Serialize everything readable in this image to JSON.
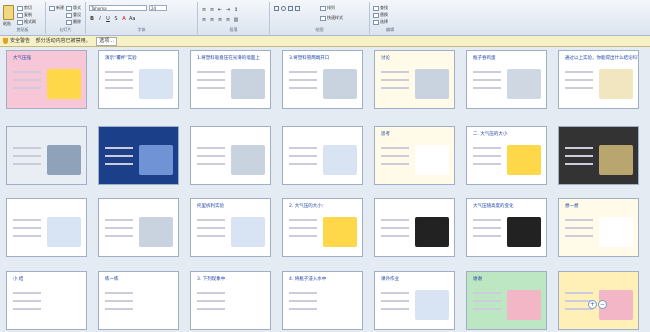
{
  "ribbon": {
    "clipboard": {
      "paste": "粘贴",
      "cut": "剪切",
      "copy": "复制",
      "format": "格式刷",
      "group": "剪贴板"
    },
    "slides": {
      "new": "新建",
      "layout": "版式",
      "reset": "重设",
      "delete": "删除",
      "group": "幻灯片"
    },
    "font": {
      "name": "Tahoma",
      "size": "24",
      "group": "字体"
    },
    "paragraph": {
      "group": "段落"
    },
    "drawing": {
      "arrange": "排列",
      "quick_styles": "快速样式",
      "group": "绘图"
    },
    "editing": {
      "find": "查找",
      "replace": "替换",
      "select": "选择",
      "group": "编辑"
    }
  },
  "security": {
    "label": "安全警告",
    "message": "部分活动内容已被禁用。",
    "button": "选项..."
  },
  "slides": [
    {
      "title": "大气压强"
    },
    {
      "title": "演示“覆杯”实验"
    },
    {
      "title": "1.将塑料吸盘压在光滑的墙面上"
    },
    {
      "title": "3.将塑料管两端开口"
    },
    {
      "title": "讨论"
    },
    {
      "title": "瓶子吞鸡蛋"
    },
    {
      "title": "通过以上实验，你能得出什么结论吗？"
    },
    {
      "title": ""
    },
    {
      "title": ""
    },
    {
      "title": ""
    },
    {
      "title": ""
    },
    {
      "title": "思考"
    },
    {
      "title": "二. 大气压的大小"
    },
    {
      "title": ""
    },
    {
      "title": ""
    },
    {
      "title": ""
    },
    {
      "title": "托里拆利实验"
    },
    {
      "title": "2. 大气压的大小："
    },
    {
      "title": ""
    },
    {
      "title": "大气压随高度的变化"
    },
    {
      "title": "想一想"
    },
    {
      "title": "小 结"
    },
    {
      "title": "练一练"
    },
    {
      "title": "3. 下列现象中"
    },
    {
      "title": "4. 将瓶子浸入水中"
    },
    {
      "title": "课外作业"
    },
    {
      "title": "谢谢"
    },
    {
      "title": ""
    }
  ],
  "zoom": {
    "plus": "+",
    "minus": "−"
  }
}
